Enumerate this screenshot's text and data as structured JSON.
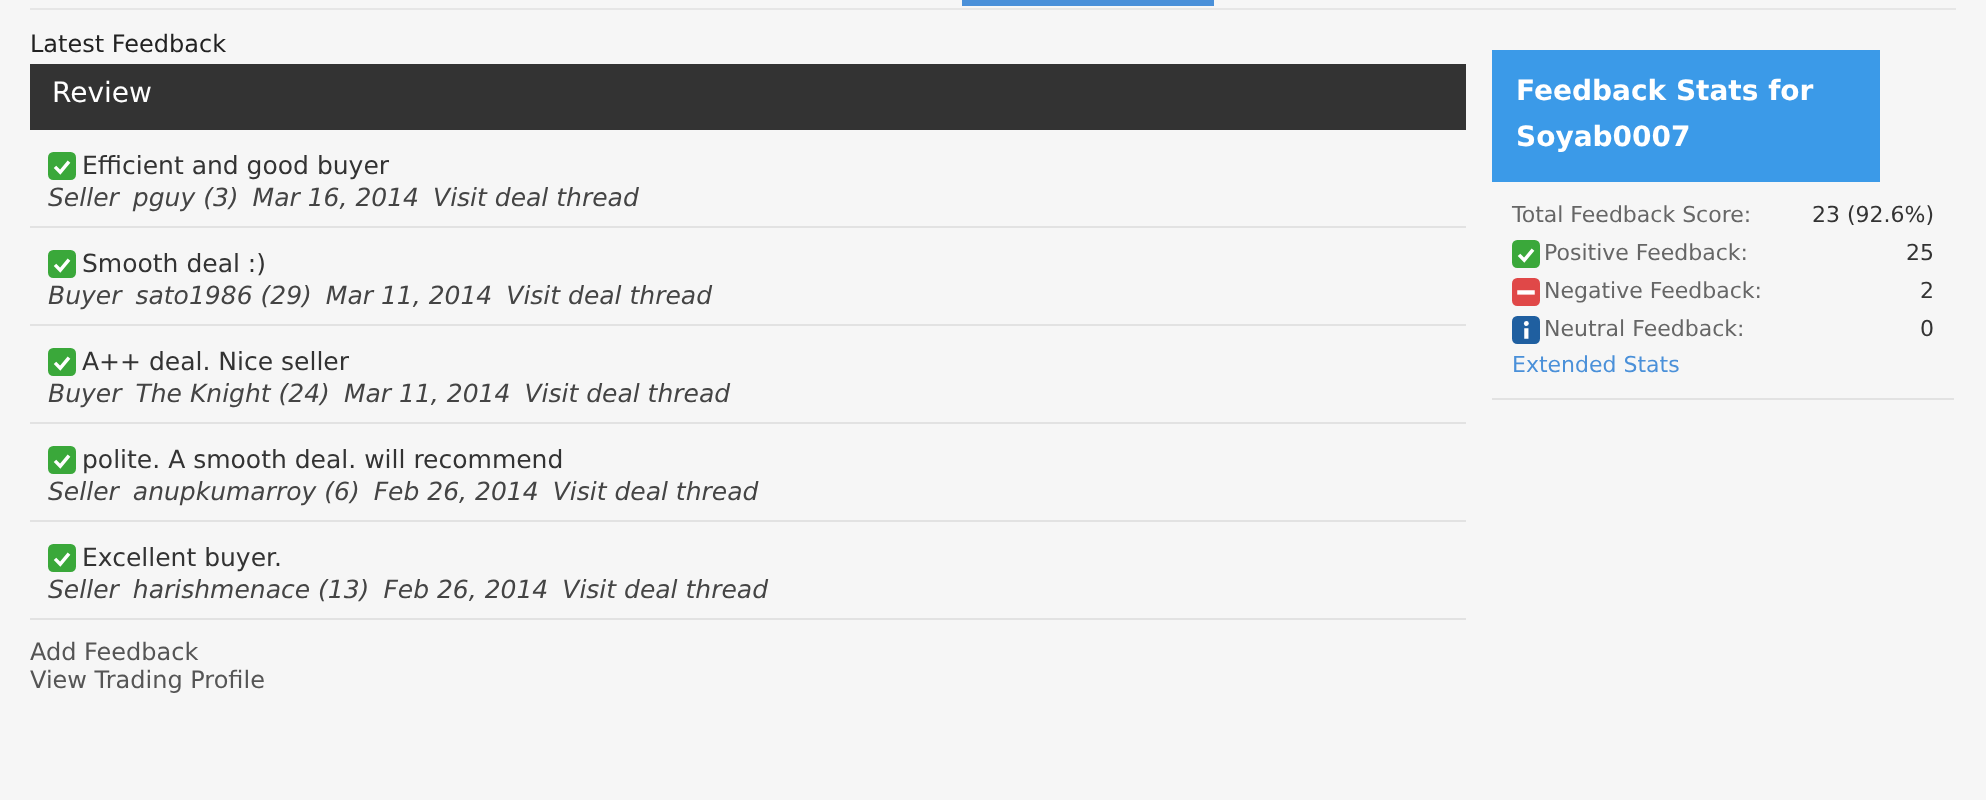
{
  "section_title": "Latest Feedback",
  "table": {
    "header": "Review",
    "rows": [
      {
        "kind": "positive",
        "comment": "Efficient and good buyer",
        "role": "Seller",
        "user": "pguy (3)",
        "date": "Mar 16, 2014",
        "link": "Visit deal thread"
      },
      {
        "kind": "positive",
        "comment": "Smooth deal :)",
        "role": "Buyer",
        "user": "sato1986 (29)",
        "date": "Mar 11, 2014",
        "link": "Visit deal thread"
      },
      {
        "kind": "positive",
        "comment": "A++ deal. Nice seller",
        "role": "Buyer",
        "user": "The Knight (24)",
        "date": "Mar 11, 2014",
        "link": "Visit deal thread"
      },
      {
        "kind": "positive",
        "comment": "polite. A smooth deal. will recommend",
        "role": "Seller",
        "user": "anupkumarroy (6)",
        "date": "Feb 26, 2014",
        "link": "Visit deal thread"
      },
      {
        "kind": "positive",
        "comment": "Excellent buyer.",
        "role": "Seller",
        "user": "harishmenace (13)",
        "date": "Feb 26, 2014",
        "link": "Visit deal thread"
      }
    ]
  },
  "links": [
    "Add Feedback",
    "View Trading Profile"
  ],
  "stats": {
    "title": "Feedback Stats for Soyab0007",
    "rows": [
      {
        "kind": "total",
        "label": "Total Feedback Score:",
        "value": "23 (92.6%)"
      },
      {
        "kind": "positive",
        "label": "Positive Feedback:",
        "value": "25"
      },
      {
        "kind": "negative",
        "label": "Negative Feedback:",
        "value": "2"
      },
      {
        "kind": "neutral",
        "label": "Neutral Feedback:",
        "value": "0"
      }
    ],
    "link": "Extended Stats"
  }
}
